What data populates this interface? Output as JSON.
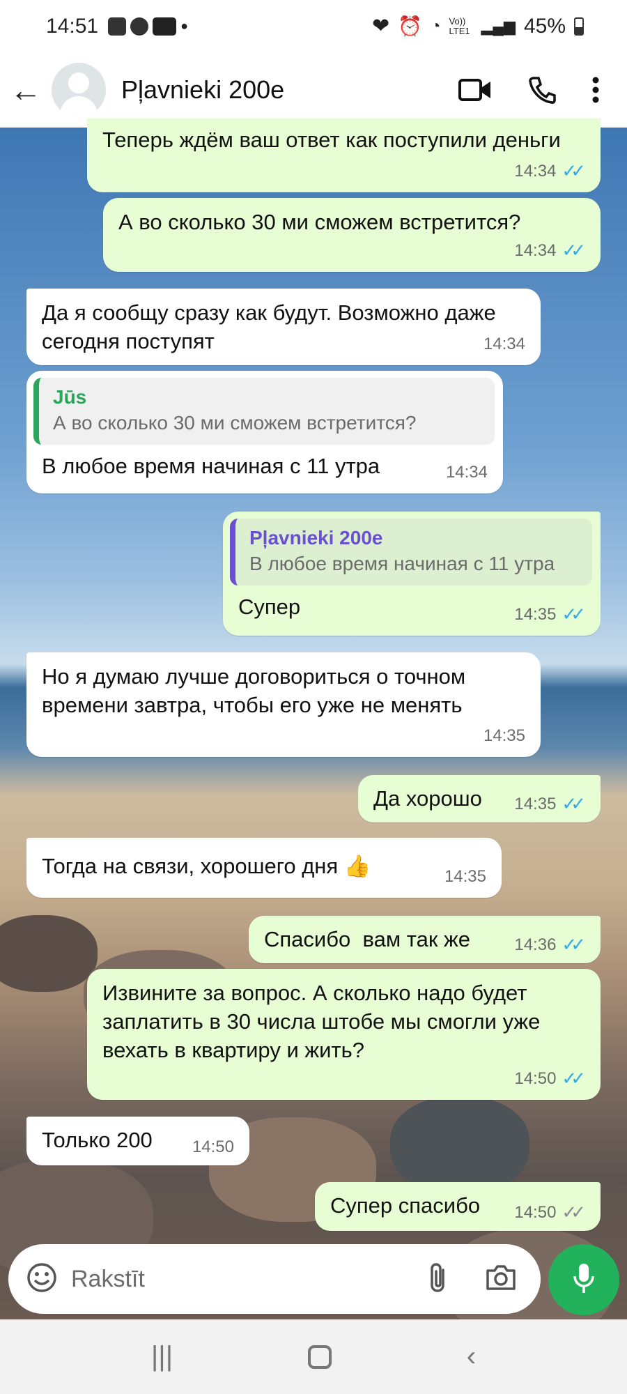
{
  "status_bar": {
    "time": "14:51",
    "network": "Vo)) LTE1",
    "battery": "45%"
  },
  "header": {
    "contact_name": "Pļavnieki 200e"
  },
  "messages": [
    {
      "dir": "out",
      "text": "Теперь ждём ваш ответ как поступили деньги",
      "time": "14:34",
      "ticks": "read"
    },
    {
      "dir": "out",
      "text": "А во сколько 30 ми сможем встретится?",
      "time": "14:34",
      "ticks": "read"
    },
    {
      "dir": "in",
      "text": "Да я сообщу сразу как будут. Возможно даже сегодня поступят",
      "time": "14:34"
    },
    {
      "dir": "in",
      "quote": {
        "name": "Jūs",
        "text": "А во сколько 30 ми сможем встретится?"
      },
      "text": "В любое время начиная с 11 утра",
      "time": "14:34"
    },
    {
      "dir": "out",
      "quote": {
        "name": "Pļavnieki 200e",
        "text": "В любое время начиная с 11 утра"
      },
      "text": "Супер",
      "time": "14:35",
      "ticks": "read"
    },
    {
      "dir": "in",
      "text": "Но я думаю лучше договориться о точном времени завтра, чтобы его уже не менять",
      "time": "14:35"
    },
    {
      "dir": "out",
      "text": "Да хорошо",
      "time": "14:35",
      "ticks": "read"
    },
    {
      "dir": "in",
      "text": "Тогда на связи, хорошего дня 👍",
      "time": "14:35"
    },
    {
      "dir": "out",
      "text": "Спасибо  вам так же",
      "time": "14:36",
      "ticks": "read"
    },
    {
      "dir": "out",
      "text": "Извините за вопрос. А сколько надо будет заплатить в 30 числа штобе мы смогли уже вехать в квартиру и жить?",
      "time": "14:50",
      "ticks": "read"
    },
    {
      "dir": "in",
      "text": "Только 200",
      "time": "14:50"
    },
    {
      "dir": "out",
      "text": "Супер спасибо",
      "time": "14:50",
      "ticks": "delivered"
    }
  ],
  "composer": {
    "placeholder": "Rakstīt"
  },
  "colors": {
    "accent": "#21b25b",
    "outgoing_bubble": "#e7fdd3",
    "incoming_bubble": "#ffffff",
    "read_ticks": "#34a9e8"
  }
}
